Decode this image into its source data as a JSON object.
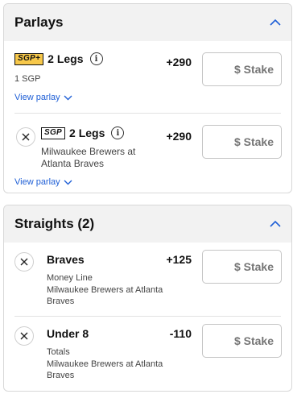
{
  "parlays": {
    "title": "Parlays",
    "items": [
      {
        "badge": "SGP+",
        "legs_label": "2 Legs",
        "odds": "+290",
        "subtitle": "1 SGP",
        "view_label": "View parlay",
        "stake_placeholder": "$ Stake"
      },
      {
        "badge": "SGP",
        "legs_label": "2 Legs",
        "odds": "+290",
        "matchup": "Milwaukee Brewers at\nAtlanta Braves",
        "view_label": "View parlay",
        "stake_placeholder": "$ Stake"
      }
    ]
  },
  "straights": {
    "title": "Straights (2)",
    "items": [
      {
        "selection": "Braves",
        "odds": "+125",
        "market": "Money Line",
        "matchup": "Milwaukee Brewers at Atlanta\nBraves",
        "stake_placeholder": "$ Stake"
      },
      {
        "selection": "Under 8",
        "odds": "-110",
        "market": "Totals",
        "matchup": "Milwaukee Brewers at Atlanta\nBraves",
        "stake_placeholder": "$ Stake"
      }
    ]
  },
  "colors": {
    "accent": "#1f5fd6",
    "header_bg": "#f2f2f2",
    "sgp_plus_badge": "#f7c84a"
  }
}
